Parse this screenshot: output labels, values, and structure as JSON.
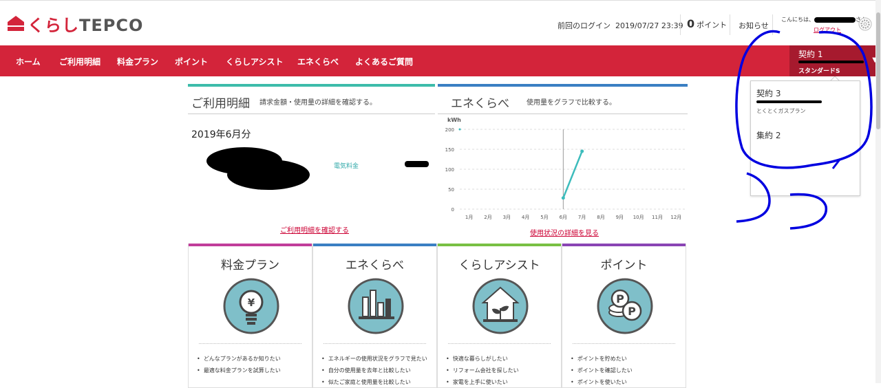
{
  "header": {
    "logo_kana": "くらし",
    "logo_latin": "TEPCO",
    "last_login_label": "前回のログイン",
    "last_login_value": "2019/07/27 23:39",
    "points_value": "0",
    "points_unit": "ポイント",
    "notice": "お知らせ",
    "greeting": "こんにちは、",
    "greeting_suffix": "さん",
    "logout": "ログアウト"
  },
  "nav": {
    "items": [
      "ホーム",
      "ご利用明細",
      "料金プラン",
      "ポイント",
      "くらしアシスト",
      "エネくらべ",
      "よくあるご質問"
    ]
  },
  "contract": {
    "title": "契約 1",
    "plan": "スタンダードS",
    "dropdown": [
      {
        "label": "契約 3",
        "sub": "とくとくガスプラン"
      },
      {
        "label": "集約 2"
      }
    ]
  },
  "usage": {
    "title": "ご利用明細",
    "desc": "請求金額・使用量の詳細を確認する。",
    "month": "2019年6月分",
    "electric_label": "電気料金",
    "link": "ご利用明細を確認する"
  },
  "compare": {
    "title": "エネくらべ",
    "desc": "使用量をグラフで比較する。",
    "link": "使用状況の詳細を見る"
  },
  "chart_data": {
    "type": "line",
    "ylabel": "kWh",
    "x": [
      "1月",
      "2月",
      "3月",
      "4月",
      "5月",
      "6月",
      "7月",
      "8月",
      "9月",
      "10月",
      "11月",
      "12月"
    ],
    "series": [
      {
        "values": [
          null,
          null,
          null,
          null,
          null,
          28,
          145,
          null,
          null,
          null,
          null,
          null
        ]
      }
    ],
    "yticks": [
      "0",
      "50",
      "100",
      "150",
      "200"
    ],
    "ylim": [
      0,
      200
    ],
    "grid": true,
    "color": "#3dbcbc"
  },
  "cards": [
    {
      "title": "料金プラン",
      "color": "#c13d9a",
      "icon": "lightbulb-yen-icon",
      "items": [
        "どんなプランがあるか知りたい",
        "最適な料金プランを試算したい"
      ]
    },
    {
      "title": "エネくらべ",
      "color": "#3a7fc3",
      "icon": "bar-chart-icon",
      "items": [
        "エネルギーの使用状況をグラフで見たい",
        "自分の使用量を去年と比較したい",
        "似たご家庭と使用量を比較したい"
      ]
    },
    {
      "title": "くらしアシスト",
      "color": "#79c043",
      "icon": "house-plant-icon",
      "items": [
        "快適な暮らしがしたい",
        "リフォーム会社を探したい",
        "家電を上手に使いたい"
      ]
    },
    {
      "title": "ポイント",
      "color": "#8a44b4",
      "icon": "point-coins-icon",
      "items": [
        "ポイントを貯めたい",
        "ポイントを確認したい",
        "ポイントを使いたい"
      ]
    }
  ]
}
